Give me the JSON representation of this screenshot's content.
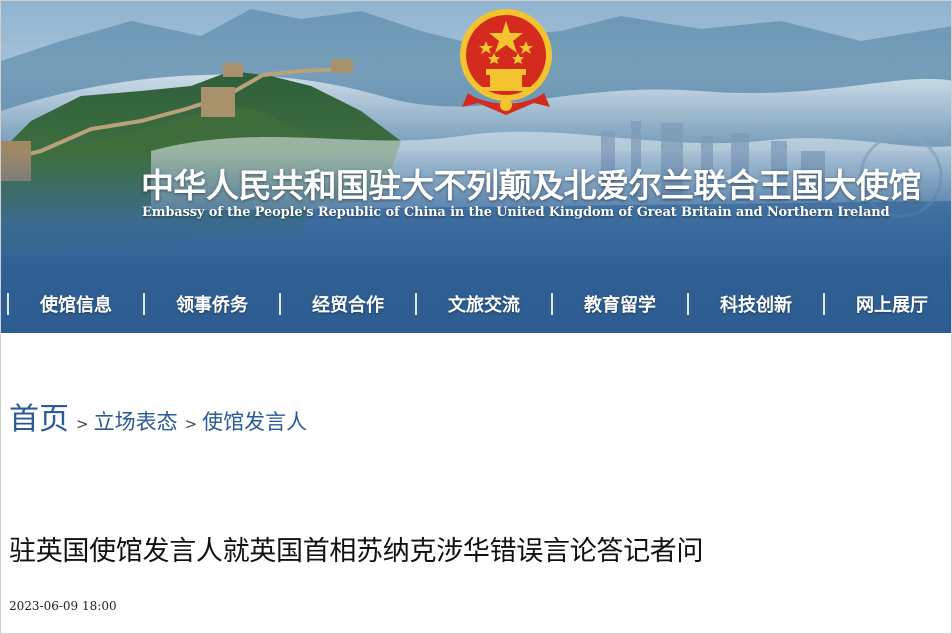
{
  "header": {
    "title_cn": "中华人民共和国驻大不列颠及北爱尔兰联合王国大使馆",
    "title_en": "Embassy of the People's Republic of China in the United Kingdom of Great Britain and Northern Ireland"
  },
  "nav": {
    "items": [
      {
        "label": "使馆信息"
      },
      {
        "label": "领事侨务"
      },
      {
        "label": "经贸合作"
      },
      {
        "label": "文旅交流"
      },
      {
        "label": "教育留学"
      },
      {
        "label": "科技创新"
      },
      {
        "label": "网上展厅"
      }
    ]
  },
  "breadcrumb": {
    "home": "首页",
    "separator": ">",
    "items": [
      "立场表态",
      "使馆发言人"
    ]
  },
  "article": {
    "title": "驻英国使馆发言人就英国首相苏纳克涉华错误言论答记者问",
    "date": "2023-06-09 18:00"
  },
  "colors": {
    "link_blue": "#2b5a96",
    "banner_blue": "#2a5a8e",
    "emblem_red": "#d52b1e",
    "emblem_gold": "#f4c430"
  },
  "icons": {
    "emblem": "national-emblem-icon"
  }
}
